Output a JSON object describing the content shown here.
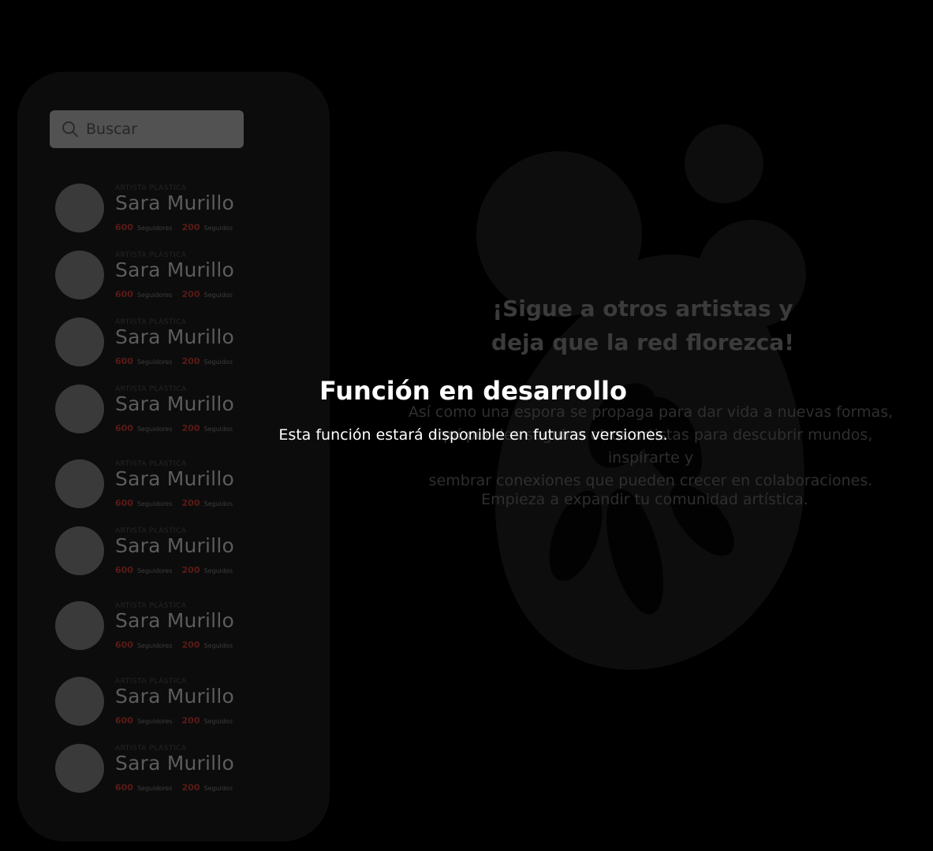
{
  "search": {
    "placeholder": "Buscar",
    "icon": "search-icon"
  },
  "users": [
    {
      "role": "ARTISTA PLÁSTICA",
      "name": "Sara Murillo",
      "followers": "600",
      "followers_label": "Seguidores",
      "following": "200",
      "following_label": "Seguidos"
    },
    {
      "role": "ARTISTA PLÁSTICA",
      "name": "Sara Murillo",
      "followers": "600",
      "followers_label": "Seguidores",
      "following": "200",
      "following_label": "Seguidos"
    },
    {
      "role": "ARTISTA PLÁSTICA",
      "name": "Sara Murillo",
      "followers": "600",
      "followers_label": "Seguidores",
      "following": "200",
      "following_label": "Seguidos"
    },
    {
      "role": "ARTISTA PLÁSTICA",
      "name": "Sara Murillo",
      "followers": "600",
      "followers_label": "Seguidores",
      "following": "200",
      "following_label": "Seguidos"
    },
    {
      "role": "ARTISTA PLÁSTICA",
      "name": "Sara Murillo",
      "followers": "600",
      "followers_label": "Seguidores",
      "following": "200",
      "following_label": "Seguidos"
    },
    {
      "role": "ARTISTA PLÁSTICA",
      "name": "Sara Murillo",
      "followers": "600",
      "followers_label": "Seguidores",
      "following": "200",
      "following_label": "Seguidos"
    },
    {
      "role": "ARTISTA PLÁSTICA",
      "name": "Sara Murillo",
      "followers": "600",
      "followers_label": "Seguidores",
      "following": "200",
      "following_label": "Seguidos"
    },
    {
      "role": "ARTISTA PLÁSTICA",
      "name": "Sara Murillo",
      "followers": "600",
      "followers_label": "Seguidores",
      "following": "200",
      "following_label": "Seguidos"
    },
    {
      "role": "ARTISTA PLÁSTICA",
      "name": "Sara Murillo",
      "followers": "600",
      "followers_label": "Seguidores",
      "following": "200",
      "following_label": "Seguidos"
    }
  ],
  "hero": {
    "title_lines": [
      "¡Sigue a otros artistas y",
      "deja que la red florezca!"
    ],
    "body_lines": [
      "Así como una espora se propaga para dar vida a nuevas formas,",
      "aquí puedes seguir a otros artistas para descubrir mundos, inspirarte y",
      "sembrar conexiones que pueden crecer en colaboraciones."
    ],
    "cta": "Empieza a expandir tu comunidad artística."
  },
  "notice": {
    "title": "Función en desarrollo",
    "body": "Esta función estará disponible en futuras versiones."
  },
  "colors": {
    "background": "#000000",
    "panel": "#0c0c0c",
    "accent": "#5a1a17",
    "overlay_text": "#ffffff"
  }
}
